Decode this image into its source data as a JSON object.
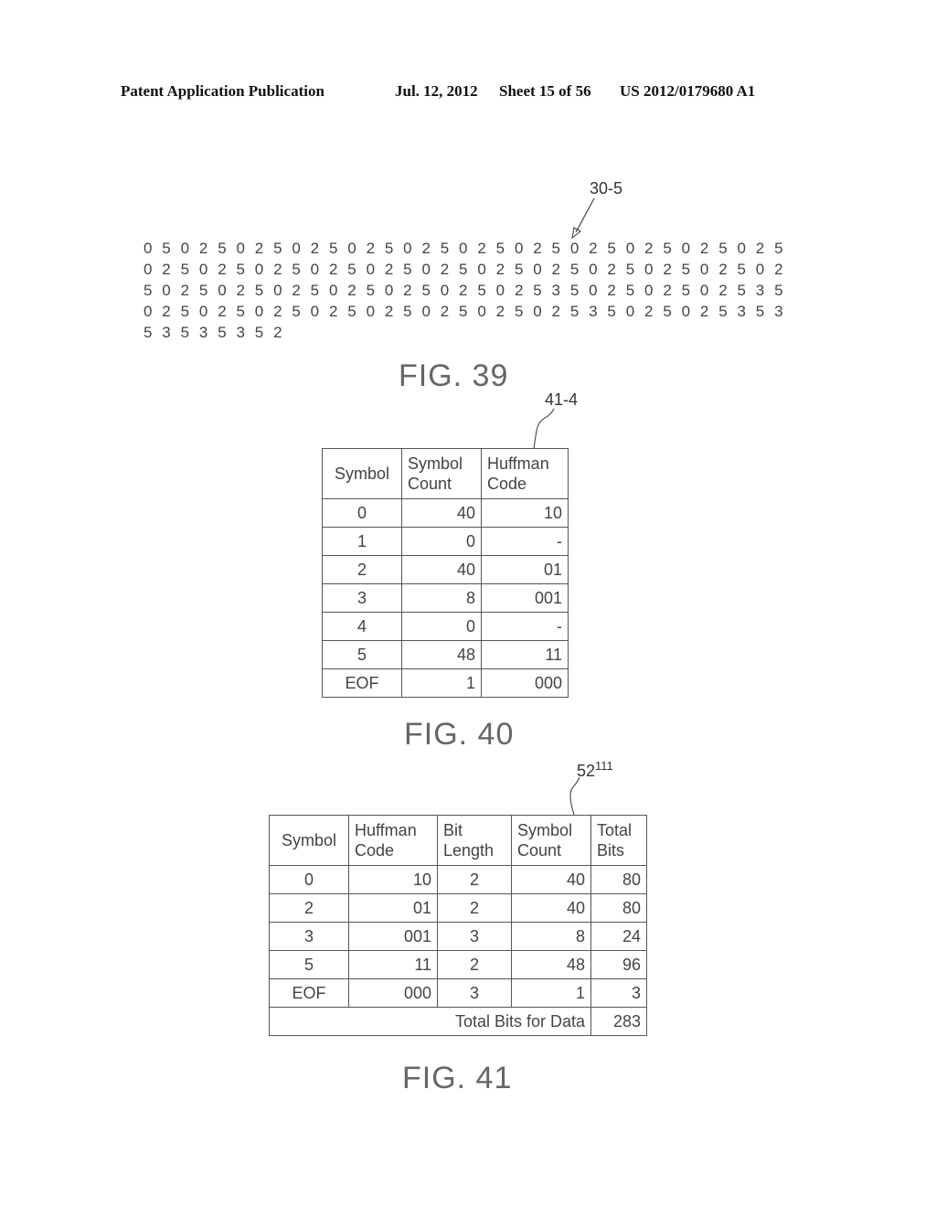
{
  "header": {
    "publication": "Patent Application Publication",
    "date": "Jul. 12, 2012",
    "sheet": "Sheet 15 of 56",
    "number": "US 2012/0179680 A1"
  },
  "fig39": {
    "reference": "30-5",
    "caption": "FIG. 39",
    "rows": [
      [
        "0",
        "5",
        "0",
        "2",
        "5",
        "0",
        "2",
        "5",
        "0",
        "2",
        "5",
        "0",
        "2",
        "5",
        "0",
        "2",
        "5",
        "0",
        "2",
        "5",
        "0",
        "2",
        "5",
        "0",
        "2",
        "5",
        "0",
        "2",
        "5",
        "0",
        "2",
        "5",
        "0",
        "2",
        "5"
      ],
      [
        "0",
        "2",
        "5",
        "0",
        "2",
        "5",
        "0",
        "2",
        "5",
        "0",
        "2",
        "5",
        "0",
        "2",
        "5",
        "0",
        "2",
        "5",
        "0",
        "2",
        "5",
        "0",
        "2",
        "5",
        "0",
        "2",
        "5",
        "0",
        "2",
        "5",
        "0",
        "2",
        "5",
        "0",
        "2"
      ],
      [
        "5",
        "0",
        "2",
        "5",
        "0",
        "2",
        "5",
        "0",
        "2",
        "5",
        "0",
        "2",
        "5",
        "0",
        "2",
        "5",
        "0",
        "2",
        "5",
        "0",
        "2",
        "5",
        "3",
        "5",
        "0",
        "2",
        "5",
        "0",
        "2",
        "5",
        "0",
        "2",
        "5",
        "3",
        "5"
      ],
      [
        "0",
        "2",
        "5",
        "0",
        "2",
        "5",
        "0",
        "2",
        "5",
        "0",
        "2",
        "5",
        "0",
        "2",
        "5",
        "0",
        "2",
        "5",
        "0",
        "2",
        "5",
        "0",
        "2",
        "5",
        "3",
        "5",
        "0",
        "2",
        "5",
        "0",
        "2",
        "5",
        "3",
        "5",
        "3"
      ],
      [
        "5",
        "3",
        "5",
        "3",
        "5",
        "3",
        "5",
        "2"
      ]
    ]
  },
  "fig40": {
    "reference": "41-4",
    "caption": "FIG. 40",
    "headers": [
      "Symbol",
      "Symbol Count",
      "Huffman Code"
    ],
    "header_lines": [
      [
        "Symbol"
      ],
      [
        "Symbol",
        "Count"
      ],
      [
        "Huffman",
        "Code"
      ]
    ],
    "rows": [
      {
        "symbol": "0",
        "count": "40",
        "code": "10"
      },
      {
        "symbol": "1",
        "count": "0",
        "code": "-"
      },
      {
        "symbol": "2",
        "count": "40",
        "code": "01"
      },
      {
        "symbol": "3",
        "count": "8",
        "code": "001"
      },
      {
        "symbol": "4",
        "count": "0",
        "code": "-"
      },
      {
        "symbol": "5",
        "count": "48",
        "code": "11"
      },
      {
        "symbol": "EOF",
        "count": "1",
        "code": "000"
      }
    ]
  },
  "fig41": {
    "reference_main": "52",
    "reference_sup": "111",
    "caption": "FIG. 41",
    "header_lines": [
      [
        "Symbol"
      ],
      [
        "Huffman",
        "Code"
      ],
      [
        "Bit",
        "Length"
      ],
      [
        "Symbol",
        "Count"
      ],
      [
        "Total",
        "Bits"
      ]
    ],
    "rows": [
      {
        "symbol": "0",
        "code": "10",
        "bit_length": "2",
        "count": "40",
        "total_bits": "80"
      },
      {
        "symbol": "2",
        "code": "01",
        "bit_length": "2",
        "count": "40",
        "total_bits": "80"
      },
      {
        "symbol": "3",
        "code": "001",
        "bit_length": "3",
        "count": "8",
        "total_bits": "24"
      },
      {
        "symbol": "5",
        "code": "11",
        "bit_length": "2",
        "count": "48",
        "total_bits": "96"
      },
      {
        "symbol": "EOF",
        "code": "000",
        "bit_length": "3",
        "count": "1",
        "total_bits": "3"
      }
    ],
    "total_label": "Total Bits for Data",
    "total_value": "283"
  }
}
